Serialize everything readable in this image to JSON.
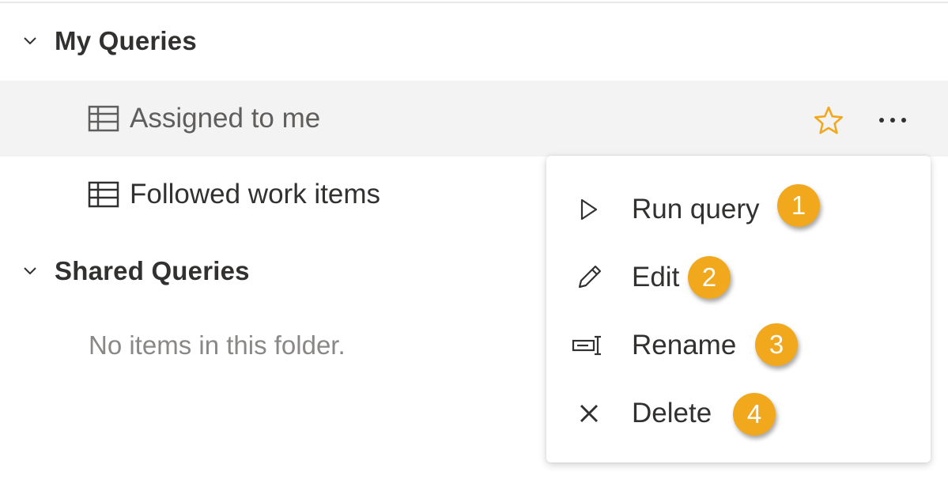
{
  "my_queries": {
    "title": "My Queries",
    "items": [
      {
        "label": "Assigned to me",
        "icon": "table-icon",
        "selected": true
      },
      {
        "label": "Followed work items",
        "icon": "table-icon",
        "selected": false
      }
    ]
  },
  "shared_queries": {
    "title": "Shared Queries",
    "empty_text": "No items in this folder."
  },
  "row_actions": {
    "favorite_icon": "star-icon",
    "more_icon": "more-options-icon",
    "star_color": "#f2a81d"
  },
  "context_menu": {
    "items": [
      {
        "label": "Run query",
        "icon": "play-icon",
        "callout": "1"
      },
      {
        "label": "Edit",
        "icon": "pencil-icon",
        "callout": "2"
      },
      {
        "label": "Rename",
        "icon": "rename-icon",
        "callout": "3"
      },
      {
        "label": "Delete",
        "icon": "close-icon",
        "callout": "4"
      }
    ]
  },
  "colors": {
    "callout": "#f2a81d",
    "selected_row": "#f3f3f4"
  }
}
